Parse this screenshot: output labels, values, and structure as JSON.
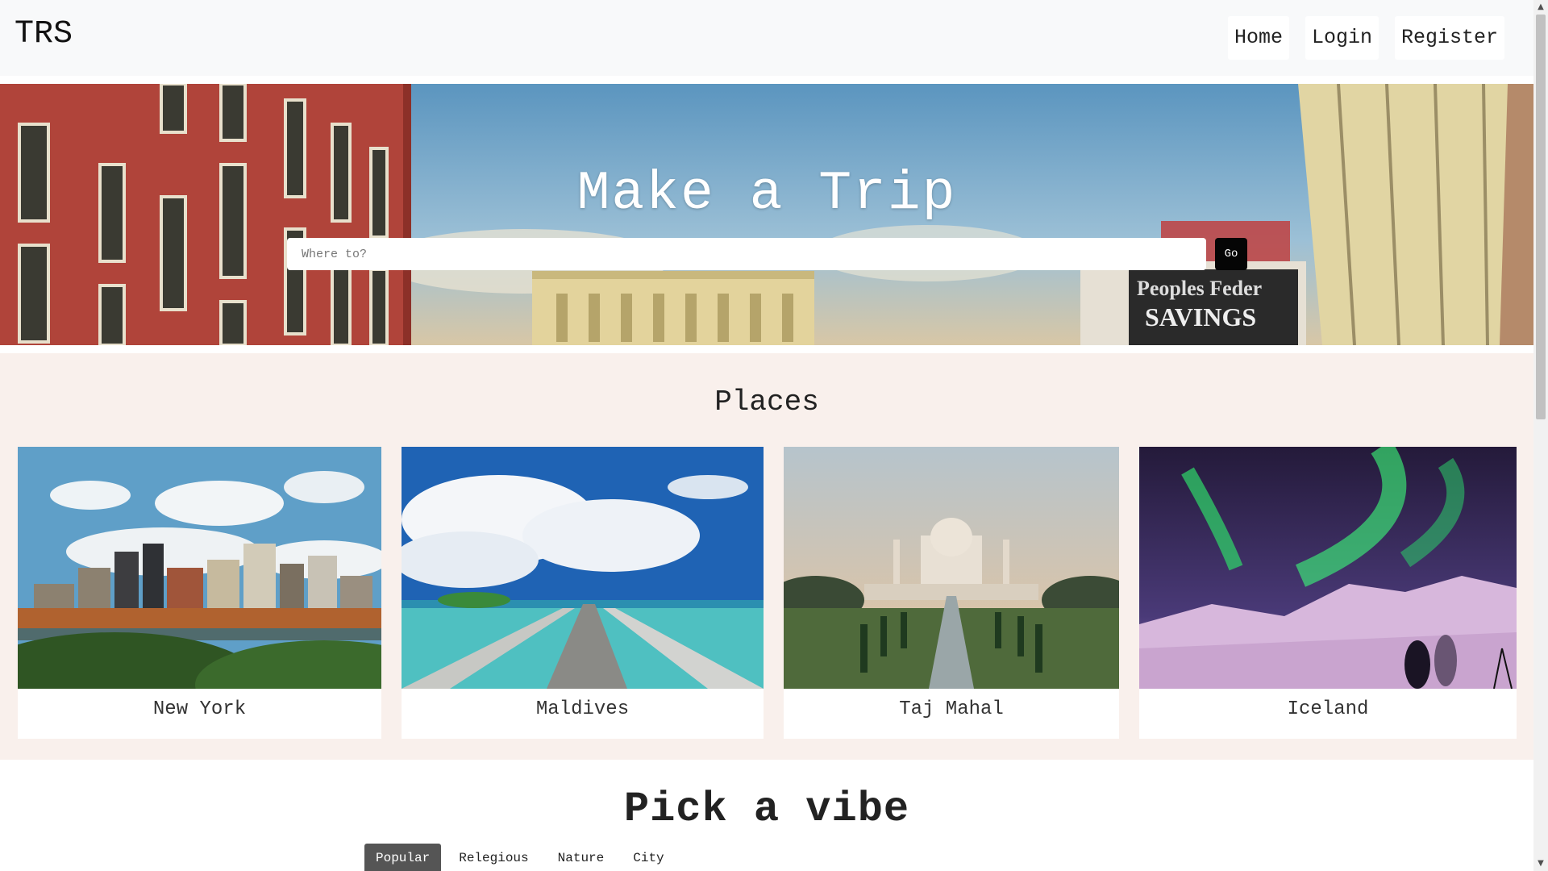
{
  "navbar": {
    "brand": "TRS",
    "links": [
      {
        "label": "Home"
      },
      {
        "label": "Login"
      },
      {
        "label": "Register"
      }
    ]
  },
  "hero": {
    "title": "Make a Trip",
    "search_placeholder": "Where to?",
    "go_label": "Go"
  },
  "places": {
    "title": "Places",
    "cards": [
      {
        "name": "New York"
      },
      {
        "name": "Maldives"
      },
      {
        "name": "Taj Mahal"
      },
      {
        "name": "Iceland"
      }
    ]
  },
  "vibe": {
    "title": "Pick a vibe",
    "tabs": [
      {
        "label": "Popular",
        "active": true
      },
      {
        "label": "Relegious"
      },
      {
        "label": "Nature"
      },
      {
        "label": "City"
      }
    ]
  },
  "colors": {
    "navbar_bg": "#f8f9fa",
    "places_bg": "#f9f0ec",
    "go_button": "#050505",
    "active_tab": "#555555"
  },
  "scrollbar": {
    "up_icon": "chevron-up-icon",
    "down_icon": "chevron-down-icon"
  }
}
